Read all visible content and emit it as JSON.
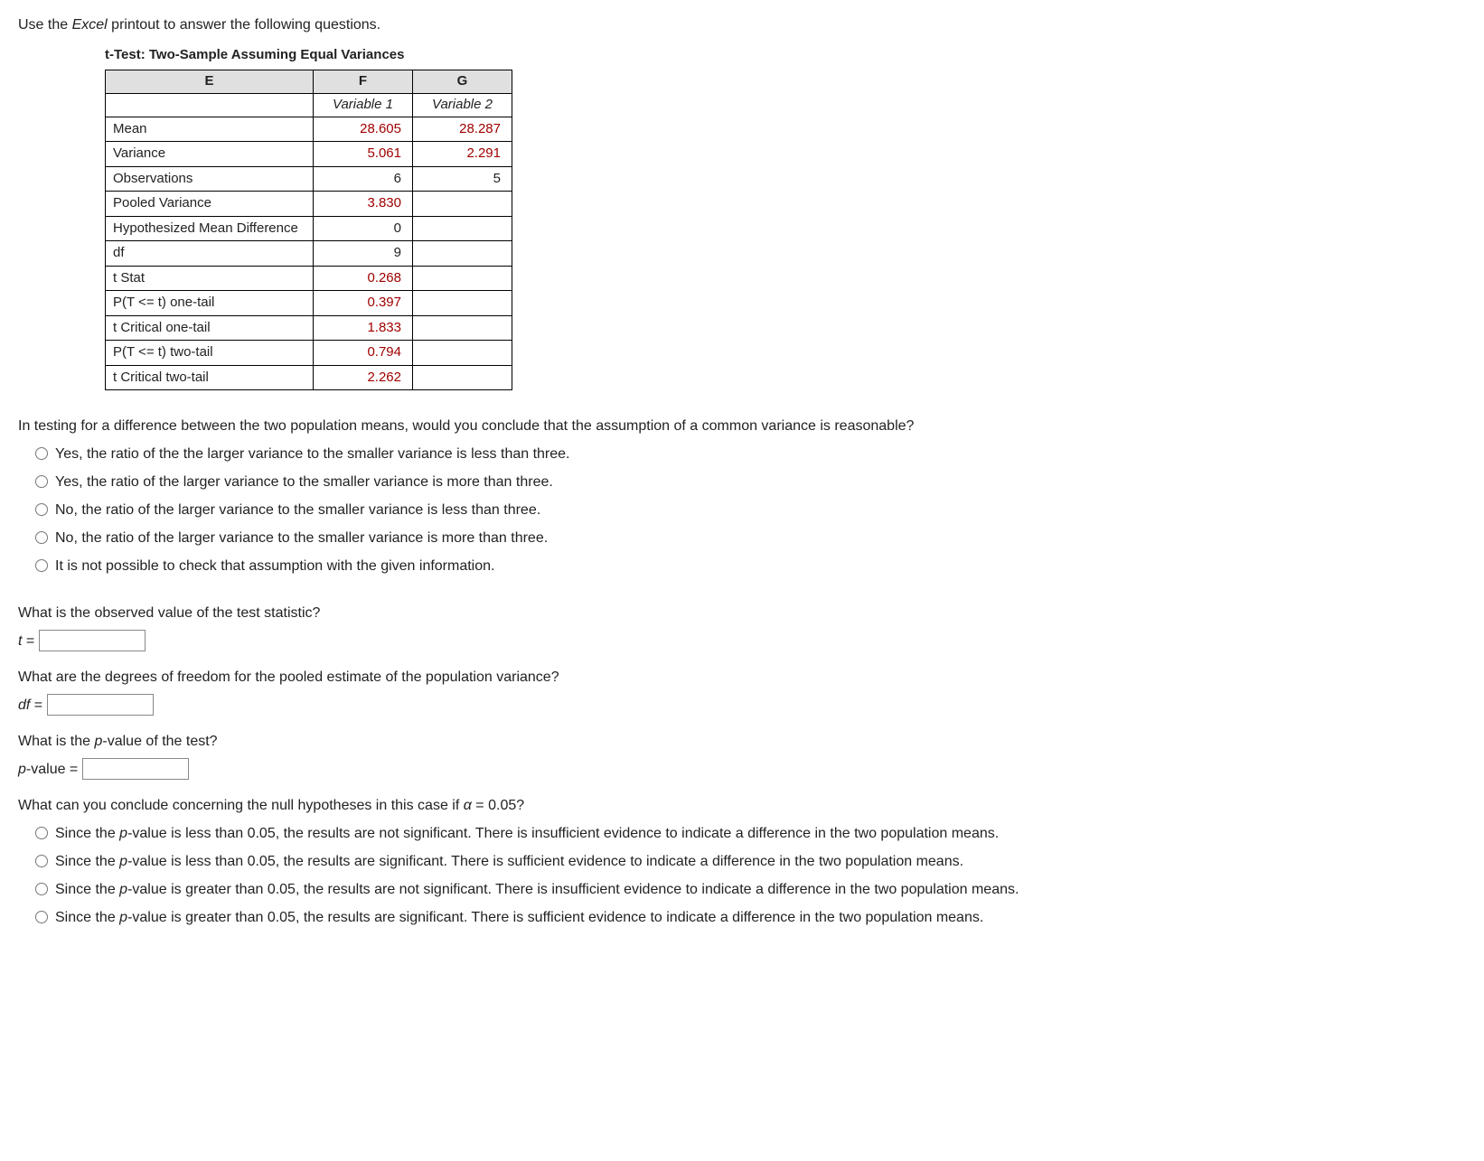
{
  "intro": {
    "prefix": "Use the ",
    "italic": "Excel",
    "suffix": " printout to answer the following questions."
  },
  "table": {
    "title": "t-Test: Two-Sample Assuming Equal Variances",
    "headers": {
      "e": "E",
      "f": "F",
      "g": "G"
    },
    "varRow": {
      "f": "Variable 1",
      "g": "Variable 2"
    },
    "rows": [
      {
        "label": "Mean",
        "f": "28.605",
        "g": "28.287",
        "red": true
      },
      {
        "label": "Variance",
        "f": "5.061",
        "g": "2.291",
        "red": true
      },
      {
        "label": "Observations",
        "f": "6",
        "g": "5",
        "red": false
      },
      {
        "label": "Pooled Variance",
        "f": "3.830",
        "g": "",
        "red": true
      },
      {
        "label": "Hypothesized Mean Difference",
        "f": "0",
        "g": "",
        "red": false
      },
      {
        "label": "df",
        "f": "9",
        "g": "",
        "red": false
      },
      {
        "label": "t Stat",
        "f": "0.268",
        "g": "",
        "red": true
      },
      {
        "label": "P(T <= t) one-tail",
        "f": "0.397",
        "g": "",
        "red": true
      },
      {
        "label": "t Critical one-tail",
        "f": "1.833",
        "g": "",
        "red": true
      },
      {
        "label": "P(T <= t) two-tail",
        "f": "0.794",
        "g": "",
        "red": true
      },
      {
        "label": "t Critical two-tail",
        "f": "2.262",
        "g": "",
        "red": true
      }
    ]
  },
  "q1": {
    "text": "In testing for a difference between the two population means, would you conclude that the assumption of a common variance is reasonable?",
    "options": [
      "Yes, the ratio of the the larger variance to the smaller variance is less than three.",
      "Yes, the ratio of the larger variance to the smaller variance is more than three.",
      "No, the ratio of the larger variance to the smaller variance is less than three.",
      "No, the ratio of the larger variance to the smaller variance is more than three.",
      "It is not possible to check that assumption with the given information."
    ]
  },
  "q2": {
    "text": "What is the observed value of the test statistic?",
    "var": "t",
    "eq": " = "
  },
  "q3": {
    "text": "What are the degrees of freedom for the pooled estimate of the population variance?",
    "var": "df",
    "eq": " = "
  },
  "q4": {
    "prefix": "What is the ",
    "italic": "p",
    "suffix": "-value of the test?",
    "var": "p",
    "varSuffix": "-value = "
  },
  "q5": {
    "prefix": "What can you conclude concerning the null hypotheses in this case if ",
    "alpha": "α",
    "suffix": " = 0.05?",
    "options": [
      {
        "prefix": "Since the ",
        "italic": "p",
        "rest": "-value is less than 0.05, the results are not significant. There is insufficient evidence to indicate a difference in the two population means."
      },
      {
        "prefix": "Since the ",
        "italic": "p",
        "rest": "-value is less than 0.05, the results are significant. There is sufficient evidence to indicate a difference in the two population means."
      },
      {
        "prefix": "Since the ",
        "italic": "p",
        "rest": "-value is greater than 0.05, the results are not significant. There is insufficient evidence to indicate a difference in the two population means."
      },
      {
        "prefix": "Since the ",
        "italic": "p",
        "rest": "-value is greater than 0.05, the results are significant. There is sufficient evidence to indicate a difference in the two population means."
      }
    ]
  }
}
